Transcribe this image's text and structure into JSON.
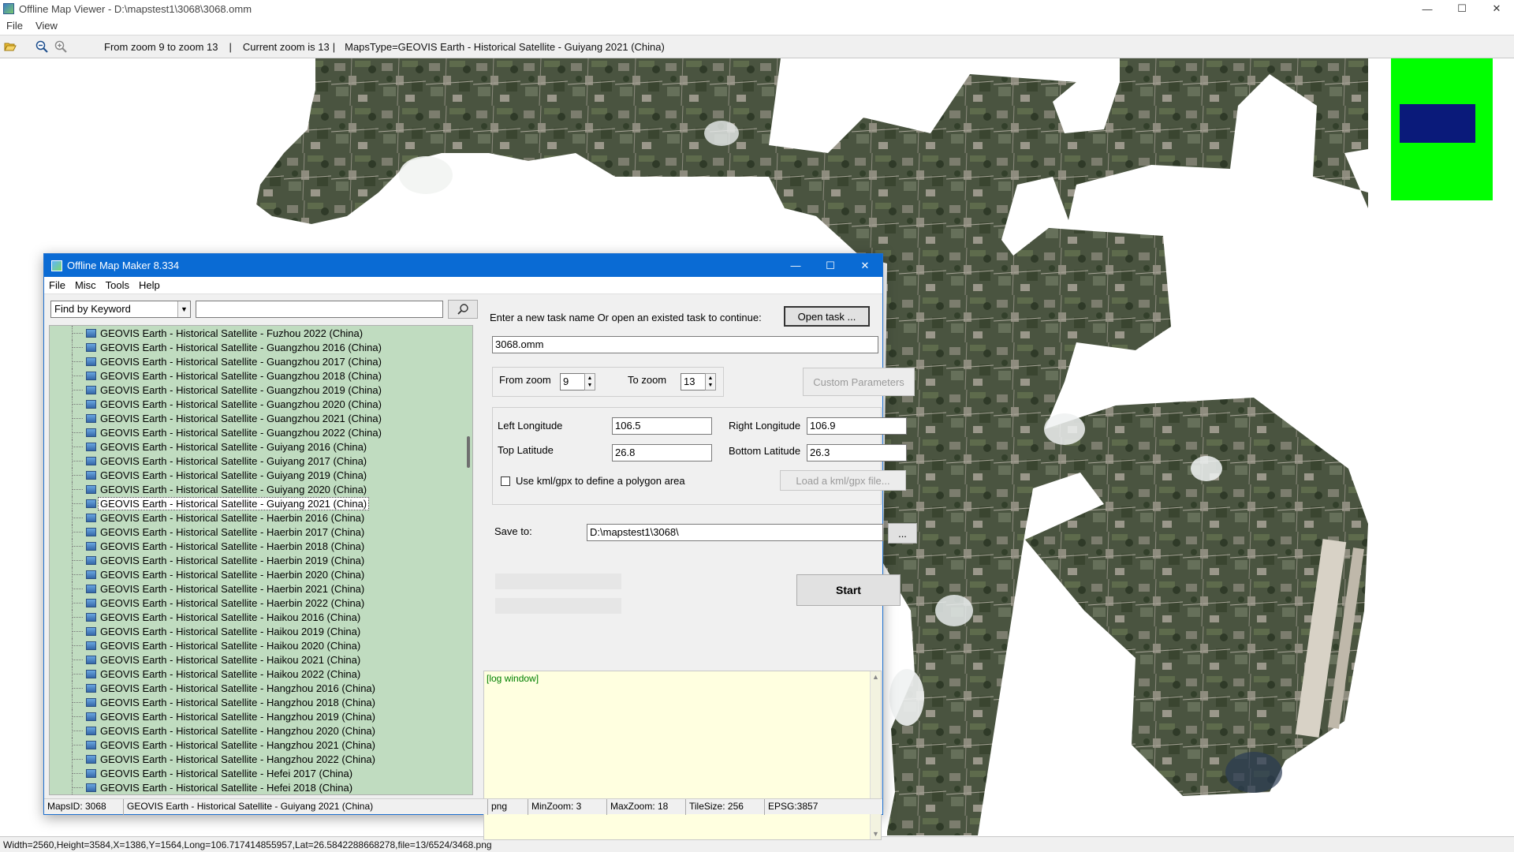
{
  "viewer": {
    "title": "Offline Map Viewer - D:\\mapstest1\\3068\\3068.omm",
    "menu": [
      "File",
      "View"
    ],
    "toolbar": {
      "zoom_range": "From zoom 9 to zoom 13",
      "sep1": "|",
      "current_zoom": "Current zoom is 13",
      "sep2": "|",
      "maps_type": "MapsType=GEOVIS Earth - Historical Satellite - Guiyang 2021 (China)"
    },
    "statusbar": "Width=2560,Height=3584,X=1386,Y=1564,Long=106.717414855957,Lat=26.5842288668278,file=13/6524/3468.png"
  },
  "window_controls": {
    "minimize": "—",
    "maximize": "☐",
    "close": "✕"
  },
  "maker": {
    "title": "Offline Map Maker 8.334",
    "menu": [
      "File",
      "Misc",
      "Tools",
      "Help"
    ],
    "search": {
      "mode": "Find by Keyword",
      "keyword": ""
    },
    "tree_items": [
      "GEOVIS Earth - Historical Satellite - Fuzhou 2022 (China)",
      "GEOVIS Earth - Historical Satellite - Guangzhou 2016 (China)",
      "GEOVIS Earth - Historical Satellite - Guangzhou 2017 (China)",
      "GEOVIS Earth - Historical Satellite - Guangzhou 2018 (China)",
      "GEOVIS Earth - Historical Satellite - Guangzhou 2019 (China)",
      "GEOVIS Earth - Historical Satellite - Guangzhou 2020 (China)",
      "GEOVIS Earth - Historical Satellite - Guangzhou 2021 (China)",
      "GEOVIS Earth - Historical Satellite - Guangzhou 2022 (China)",
      "GEOVIS Earth - Historical Satellite - Guiyang 2016 (China)",
      "GEOVIS Earth - Historical Satellite - Guiyang 2017 (China)",
      "GEOVIS Earth - Historical Satellite - Guiyang 2019 (China)",
      "GEOVIS Earth - Historical Satellite - Guiyang 2020 (China)",
      "GEOVIS Earth - Historical Satellite - Guiyang 2021 (China)",
      "GEOVIS Earth - Historical Satellite - Haerbin 2016 (China)",
      "GEOVIS Earth - Historical Satellite - Haerbin 2017 (China)",
      "GEOVIS Earth - Historical Satellite - Haerbin 2018 (China)",
      "GEOVIS Earth - Historical Satellite - Haerbin 2019 (China)",
      "GEOVIS Earth - Historical Satellite - Haerbin 2020 (China)",
      "GEOVIS Earth - Historical Satellite - Haerbin 2021 (China)",
      "GEOVIS Earth - Historical Satellite - Haerbin 2022 (China)",
      "GEOVIS Earth - Historical Satellite - Haikou 2016 (China)",
      "GEOVIS Earth - Historical Satellite - Haikou 2019 (China)",
      "GEOVIS Earth - Historical Satellite - Haikou 2020 (China)",
      "GEOVIS Earth - Historical Satellite - Haikou 2021 (China)",
      "GEOVIS Earth - Historical Satellite - Haikou 2022 (China)",
      "GEOVIS Earth - Historical Satellite - Hangzhou 2016 (China)",
      "GEOVIS Earth - Historical Satellite - Hangzhou 2018 (China)",
      "GEOVIS Earth - Historical Satellite - Hangzhou 2019 (China)",
      "GEOVIS Earth - Historical Satellite - Hangzhou 2020 (China)",
      "GEOVIS Earth - Historical Satellite - Hangzhou 2021 (China)",
      "GEOVIS Earth - Historical Satellite - Hangzhou 2022 (China)",
      "GEOVIS Earth - Historical Satellite - Hefei 2017 (China)",
      "GEOVIS Earth - Historical Satellite - Hefei 2018 (China)"
    ],
    "selected_index": 12,
    "task": {
      "prompt": "Enter a new task name Or open an existed task to continue:",
      "open_button": "Open task ...",
      "name": "3068.omm"
    },
    "zoom": {
      "from_label": "From zoom",
      "from_value": "9",
      "to_label": "To zoom",
      "to_value": "13",
      "custom_button": "Custom Parameters"
    },
    "area": {
      "left_lon_label": "Left Longitude",
      "left_lon": "106.5",
      "right_lon_label": "Right Longitude",
      "right_lon": "106.9",
      "top_lat_label": "Top Latitude",
      "top_lat": "26.8",
      "bottom_lat_label": "Bottom Latitude",
      "bottom_lat": "26.3",
      "kml_label": "Use kml/gpx to define a polygon area",
      "kml_checked": false,
      "load_kml_button": "Load a kml/gpx file..."
    },
    "save": {
      "label": "Save to:",
      "path": "D:\\mapstest1\\3068\\",
      "browse_button": "..."
    },
    "start_button": "Start",
    "log_text": "[log window]",
    "status": {
      "maps_id": "MapsID: 3068",
      "map_name": "GEOVIS Earth - Historical Satellite - Guiyang 2021 (China)",
      "format": "png",
      "min_zoom": "MinZoom: 3",
      "max_zoom": "MaxZoom: 18",
      "tile_size": "TileSize: 256",
      "epsg": "EPSG:3857"
    }
  },
  "icons": {
    "open": "folder-open-icon",
    "zoom_out": "zoom-out-icon",
    "zoom_in": "zoom-in-icon",
    "search": "search-icon",
    "map_item": "map-tile-icon"
  },
  "colors": {
    "title_blue": "#0a6bd4",
    "tree_bg": "#c0dcc0",
    "log_bg": "#ffffe0",
    "log_text": "#008000",
    "overview_green": "#00ff00",
    "overview_view": "#0a1a7a"
  }
}
